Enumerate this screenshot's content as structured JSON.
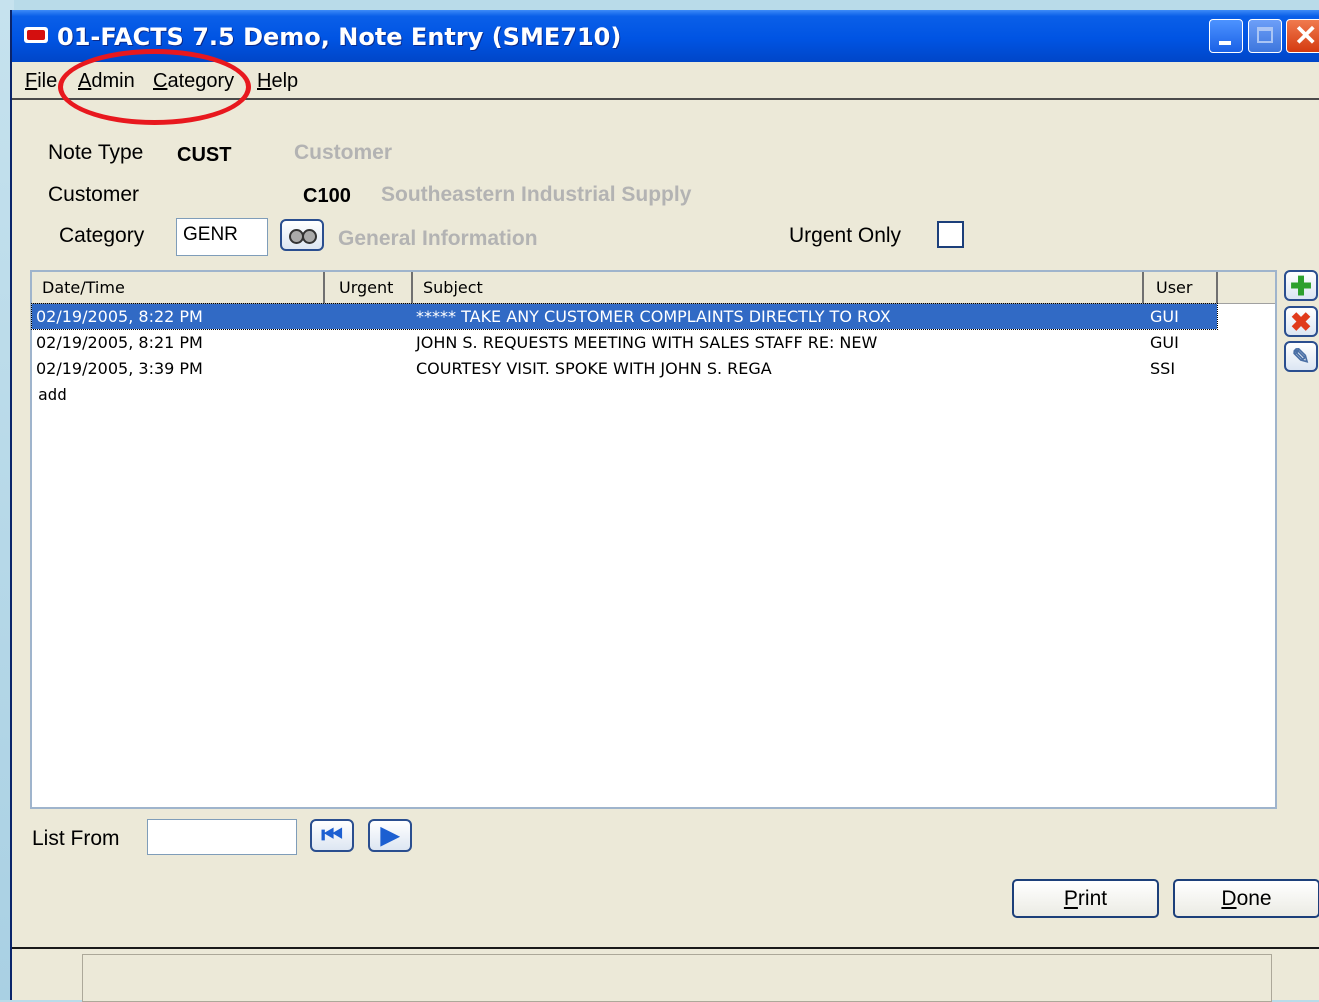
{
  "window": {
    "title": "01-FACTS 7.5 Demo, Note Entry (SME710)"
  },
  "menu": {
    "items": [
      "File",
      "Admin",
      "Category",
      "Help"
    ]
  },
  "form": {
    "note_type": {
      "label": "Note Type",
      "code": "CUST",
      "description": "Customer"
    },
    "customer": {
      "label": "Customer",
      "code": "C100",
      "description": "Southeastern Industrial Supply"
    },
    "category": {
      "label": "Category",
      "value": "GENR",
      "description": "General Information"
    },
    "urgent_only": {
      "label": "Urgent Only",
      "checked": false
    }
  },
  "grid": {
    "columns": [
      "Date/Time",
      "Urgent",
      "Subject",
      "User"
    ],
    "rows": [
      {
        "datetime": "02/19/2005, 8:22 PM",
        "urgent": "",
        "subject": "***** TAKE ANY CUSTOMER COMPLAINTS DIRECTLY TO ROX",
        "user": "GUI",
        "selected": true
      },
      {
        "datetime": "02/19/2005, 8:21 PM",
        "urgent": "",
        "subject": "JOHN S. REQUESTS MEETING WITH SALES STAFF RE: NEW",
        "user": "GUI",
        "selected": false
      },
      {
        "datetime": "02/19/2005, 3:39 PM",
        "urgent": "",
        "subject": "COURTESY VISIT. SPOKE WITH JOHN S. REGA",
        "user": "SSI",
        "selected": false
      }
    ],
    "add_row_label": "add"
  },
  "side_buttons": [
    "plus-icon",
    "delete-x-icon",
    "edit-note-icon"
  ],
  "list_from": {
    "label": "List From",
    "value": ""
  },
  "buttons": {
    "print": "Print",
    "done": "Done"
  },
  "colors": {
    "title_bar": "#0054e3",
    "selection": "#316ac5",
    "annotation_oval": "#e8181e",
    "window_bg": "#ece9d8"
  }
}
